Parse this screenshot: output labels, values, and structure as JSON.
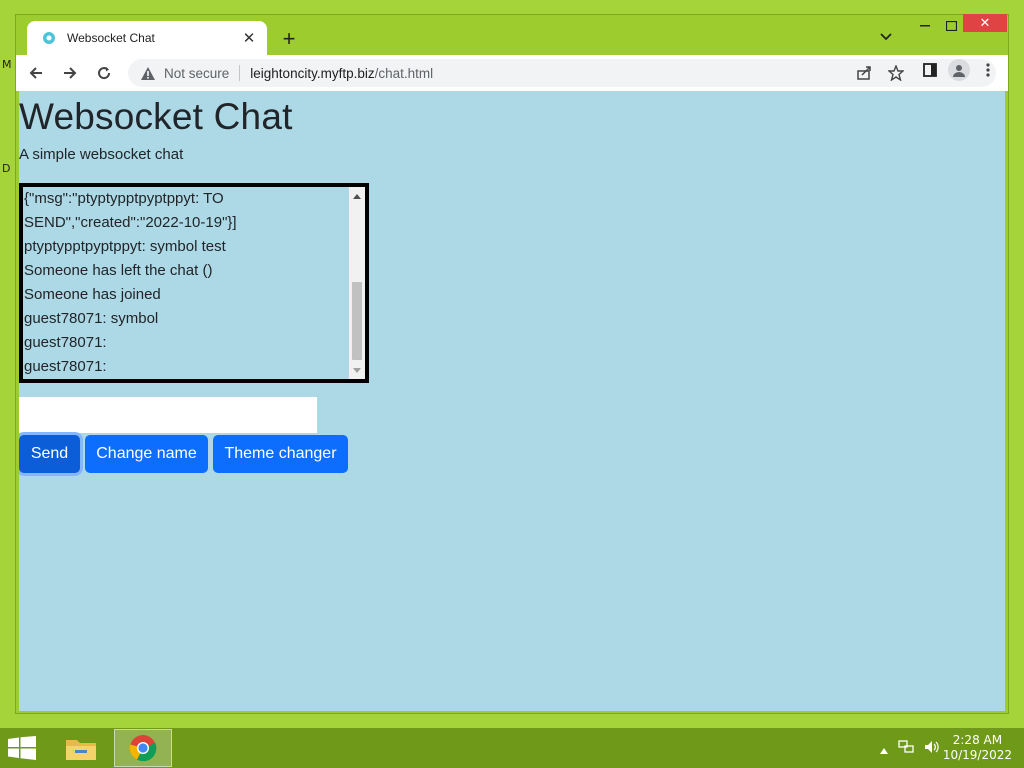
{
  "desktop": {
    "edge_glyphs": [
      "M",
      "D"
    ]
  },
  "browser": {
    "tab": {
      "title": "Websocket Chat",
      "favicon": "globe-icon"
    },
    "omnibox": {
      "security_label": "Not secure",
      "url_host": "leightoncity.myftp.biz",
      "url_path": "/chat.html"
    },
    "colors": {
      "frame": "#9ccc2e",
      "close": "#e04343"
    }
  },
  "page": {
    "title": "Websocket Chat",
    "subtitle": "A simple websocket chat",
    "chat_messages": [
      "{\"msg\":\"ptyptypptpyptppyt: TO SEND\",\"created\":\"2022-10-19\"}]",
      "ptyptypptpyptppyt: symbol test",
      "Someone has left the chat ()",
      "Someone has joined",
      "guest78071: symbol",
      "guest78071:",
      "guest78071:"
    ],
    "message_input": {
      "value": "",
      "placeholder": ""
    },
    "buttons": {
      "send": "Send",
      "change_name": "Change name",
      "theme_changer": "Theme changer"
    },
    "colors": {
      "background": "#add8e6",
      "button": "#0d6efd"
    }
  },
  "taskbar": {
    "time": "2:28 AM",
    "date": "10/19/2022"
  }
}
